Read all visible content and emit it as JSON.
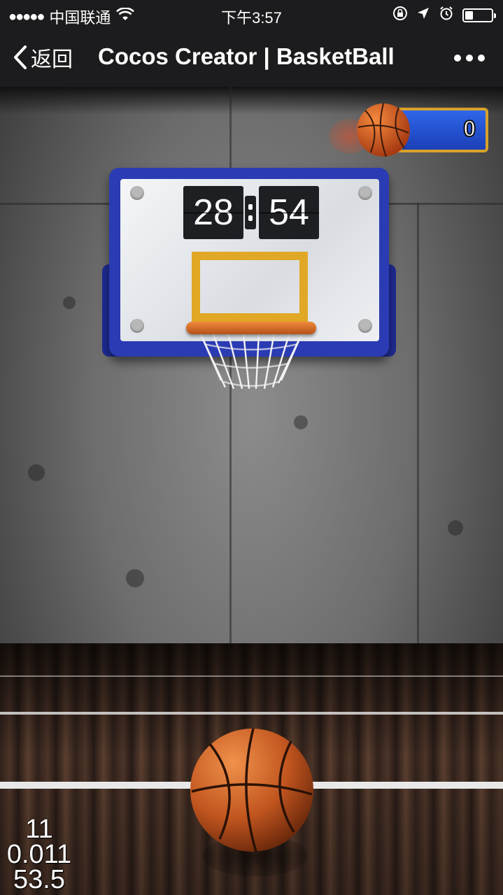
{
  "status_bar": {
    "signal_dots": "●●●●●",
    "carrier": "中国联通",
    "time": "下午3:57",
    "wifi_icon": "wifi-icon",
    "icons": [
      "rotation-lock-icon",
      "location-arrow-icon",
      "alarm-icon",
      "battery-icon"
    ],
    "battery_level": 0.3
  },
  "nav": {
    "back_label": "返回",
    "title": "Cocos Creator | BasketBall",
    "more_icon": "more-dots-icon"
  },
  "game": {
    "timer_minutes": "28",
    "timer_seconds": "54",
    "score": "0",
    "debug_stats": [
      "11",
      "0.011",
      "53.5"
    ],
    "colors": {
      "backboard_frame": "#2a3bb3",
      "score_panel": "#2f66e8",
      "score_border": "#d8a22a",
      "target_square": "#e1a826",
      "rim": "#d9642a"
    }
  }
}
